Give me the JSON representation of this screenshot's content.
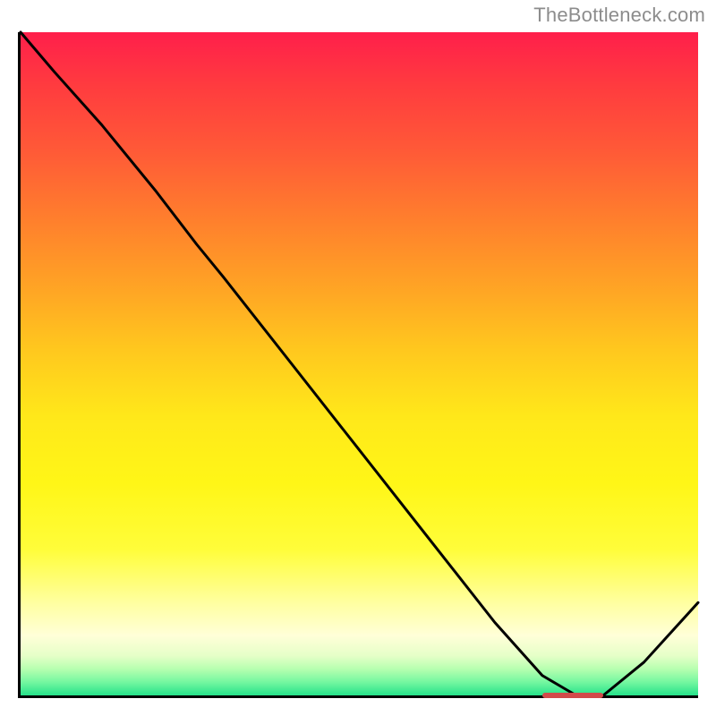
{
  "attribution": "TheBottleneck.com",
  "chart_data": {
    "type": "line",
    "title": "",
    "xlabel": "",
    "ylabel": "",
    "xlim": [
      0,
      100
    ],
    "ylim": [
      0,
      100
    ],
    "series": [
      {
        "name": "curve",
        "x": [
          0,
          5,
          12,
          20,
          26,
          30,
          40,
          50,
          60,
          70,
          77,
          82,
          86,
          92,
          100
        ],
        "values": [
          100,
          94,
          86,
          76,
          68,
          63,
          50,
          37,
          24,
          11,
          3,
          0,
          0,
          5,
          14
        ]
      }
    ],
    "marker": {
      "x_start": 77,
      "x_end": 86,
      "y": 0
    },
    "gradient_stops": [
      {
        "pos": 0,
        "color": "#ff1f4b"
      },
      {
        "pos": 50,
        "color": "#ffe81a"
      },
      {
        "pos": 90,
        "color": "#ffffd8"
      },
      {
        "pos": 100,
        "color": "#26e28a"
      }
    ]
  }
}
